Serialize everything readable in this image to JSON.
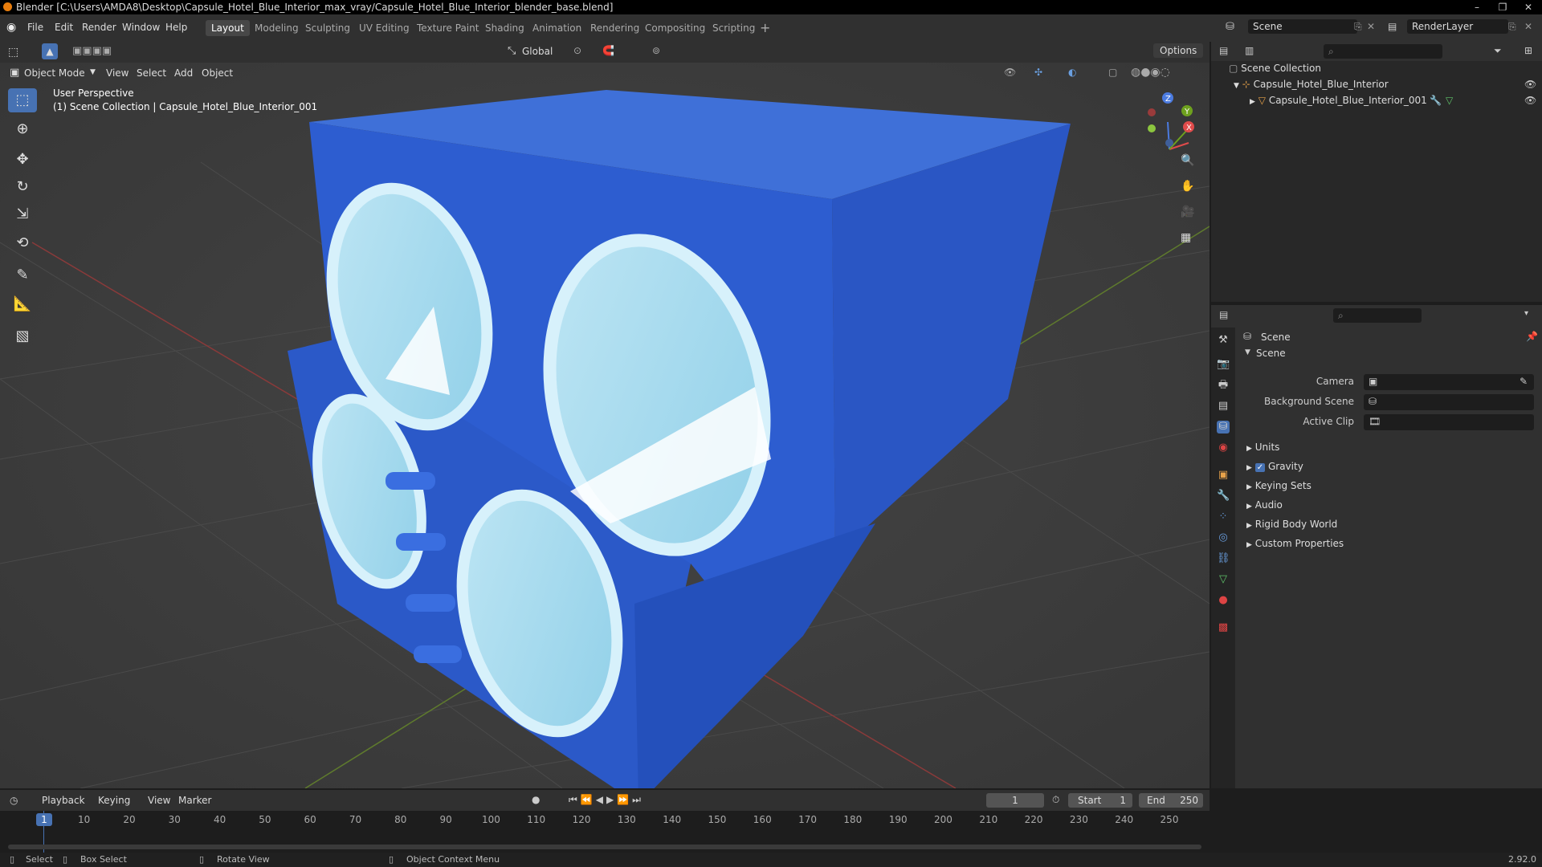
{
  "window": {
    "title": "Blender [C:\\Users\\AMDA8\\Desktop\\Capsule_Hotel_Blue_Interior_max_vray/Capsule_Hotel_Blue_Interior_blender_base.blend]"
  },
  "menu": [
    "File",
    "Edit",
    "Render",
    "Window",
    "Help"
  ],
  "workspaces": [
    "Layout",
    "Modeling",
    "Sculpting",
    "UV Editing",
    "Texture Paint",
    "Shading",
    "Animation",
    "Rendering",
    "Compositing",
    "Scripting"
  ],
  "topright": {
    "scene": "Scene",
    "view_layer": "RenderLayer"
  },
  "viewport": {
    "transform_orientation": "Global",
    "options_label": "Options",
    "mode": "Object Mode",
    "menus": [
      "View",
      "Select",
      "Add",
      "Object"
    ],
    "perspective": "User Perspective",
    "collection_info": "(1) Scene Collection | Capsule_Hotel_Blue_Interior_001",
    "gizmo": {
      "x": "X",
      "y": "Y",
      "z": "Z"
    }
  },
  "outliner": {
    "root": "Scene Collection",
    "items": [
      {
        "label": "Capsule_Hotel_Blue_Interior"
      },
      {
        "label": "Capsule_Hotel_Blue_Interior_001"
      }
    ]
  },
  "properties": {
    "context": "Scene",
    "panel": "Scene",
    "fields": [
      {
        "label": "Camera"
      },
      {
        "label": "Background Scene"
      },
      {
        "label": "Active Clip"
      }
    ],
    "subpanels": [
      "Units",
      "Gravity",
      "Keying Sets",
      "Audio",
      "Rigid Body World",
      "Custom Properties"
    ]
  },
  "timeline": {
    "menus": [
      "Playback",
      "Keying",
      "View",
      "Marker"
    ],
    "current_frame": "1",
    "start_label": "Start",
    "start": "1",
    "end_label": "End",
    "end": "250",
    "ticks": [
      "1",
      "10",
      "20",
      "30",
      "40",
      "50",
      "60",
      "70",
      "80",
      "90",
      "100",
      "110",
      "120",
      "130",
      "140",
      "150",
      "160",
      "170",
      "180",
      "190",
      "200",
      "210",
      "220",
      "230",
      "240",
      "250"
    ],
    "playhead_label": "1"
  },
  "statusbar": {
    "select": "Select",
    "box_select": "Box Select",
    "rotate": "Rotate View",
    "context_menu": "Object Context Menu",
    "version": "2.92.0"
  }
}
